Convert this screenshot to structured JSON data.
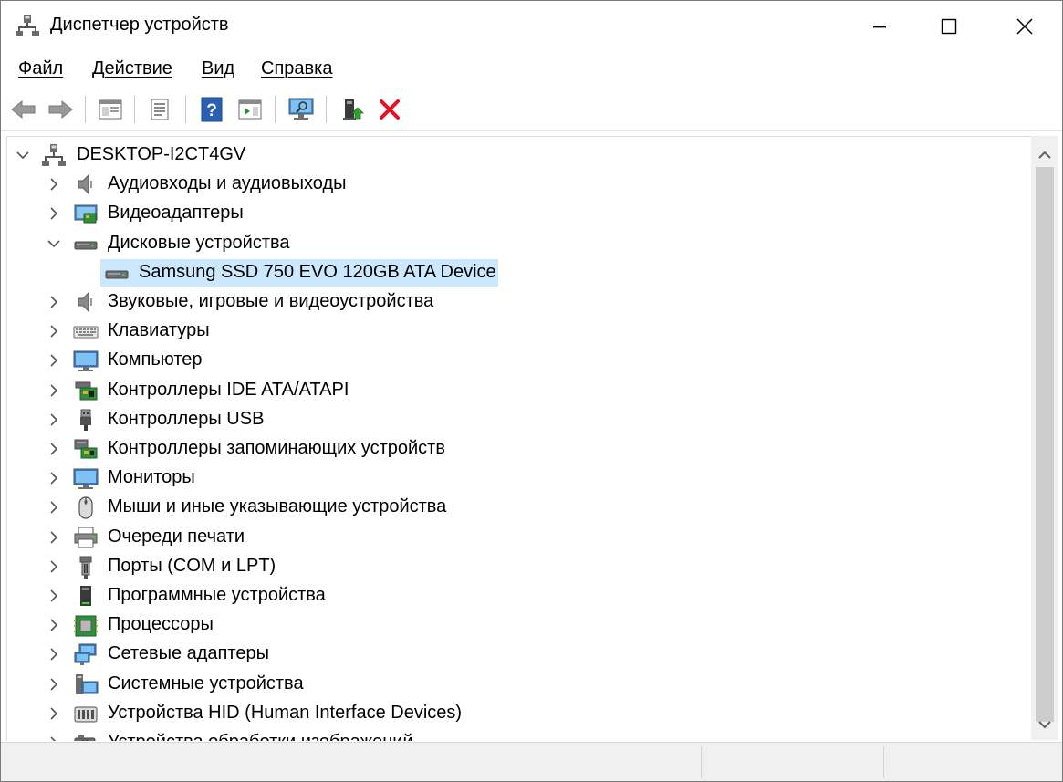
{
  "window": {
    "title": "Диспетчер устройств"
  },
  "menu": [
    {
      "label": "Файл"
    },
    {
      "label": "Действие"
    },
    {
      "label": "Вид"
    },
    {
      "label": "Справка"
    }
  ],
  "tree": {
    "root": "DESKTOP-I2CT4GV",
    "categories": [
      {
        "label": "Аудиовходы и аудиовыходы",
        "icon": "speaker-icon",
        "expanded": false
      },
      {
        "label": "Видеоадаптеры",
        "icon": "display-adapter-icon",
        "expanded": false
      },
      {
        "label": "Дисковые устройства",
        "icon": "disk-drive-icon",
        "expanded": true,
        "children": [
          {
            "label": "Samsung SSD 750 EVO 120GB ATA Device",
            "icon": "disk-drive-icon",
            "selected": true
          }
        ]
      },
      {
        "label": "Звуковые, игровые и видеоустройства",
        "icon": "speaker-icon",
        "expanded": false
      },
      {
        "label": "Клавиатуры",
        "icon": "keyboard-icon",
        "expanded": false
      },
      {
        "label": "Компьютер",
        "icon": "monitor-icon",
        "expanded": false
      },
      {
        "label": "Контроллеры IDE ATA/ATAPI",
        "icon": "ide-controller-icon",
        "expanded": false
      },
      {
        "label": "Контроллеры USB",
        "icon": "usb-icon",
        "expanded": false
      },
      {
        "label": "Контроллеры запоминающих устройств",
        "icon": "storage-controller-icon",
        "expanded": false
      },
      {
        "label": "Мониторы",
        "icon": "monitor-icon",
        "expanded": false
      },
      {
        "label": "Мыши и иные указывающие устройства",
        "icon": "mouse-icon",
        "expanded": false
      },
      {
        "label": "Очереди печати",
        "icon": "printer-icon",
        "expanded": false
      },
      {
        "label": "Порты (COM и LPT)",
        "icon": "port-icon",
        "expanded": false
      },
      {
        "label": "Программные устройства",
        "icon": "software-device-icon",
        "expanded": false
      },
      {
        "label": "Процессоры",
        "icon": "processor-icon",
        "expanded": false
      },
      {
        "label": "Сетевые адаптеры",
        "icon": "network-adapter-icon",
        "expanded": false
      },
      {
        "label": "Системные устройства",
        "icon": "system-device-icon",
        "expanded": false
      },
      {
        "label": "Устройства HID (Human Interface Devices)",
        "icon": "hid-icon",
        "expanded": false
      },
      {
        "label": "Устройства обработки изображений",
        "icon": "imaging-device-icon",
        "expanded": false
      }
    ]
  },
  "colors": {
    "selection": "#cce8ff",
    "delete_red": "#e81123",
    "help_blue": "#2b5fb4",
    "icon_blue": "#2f7fd0"
  }
}
